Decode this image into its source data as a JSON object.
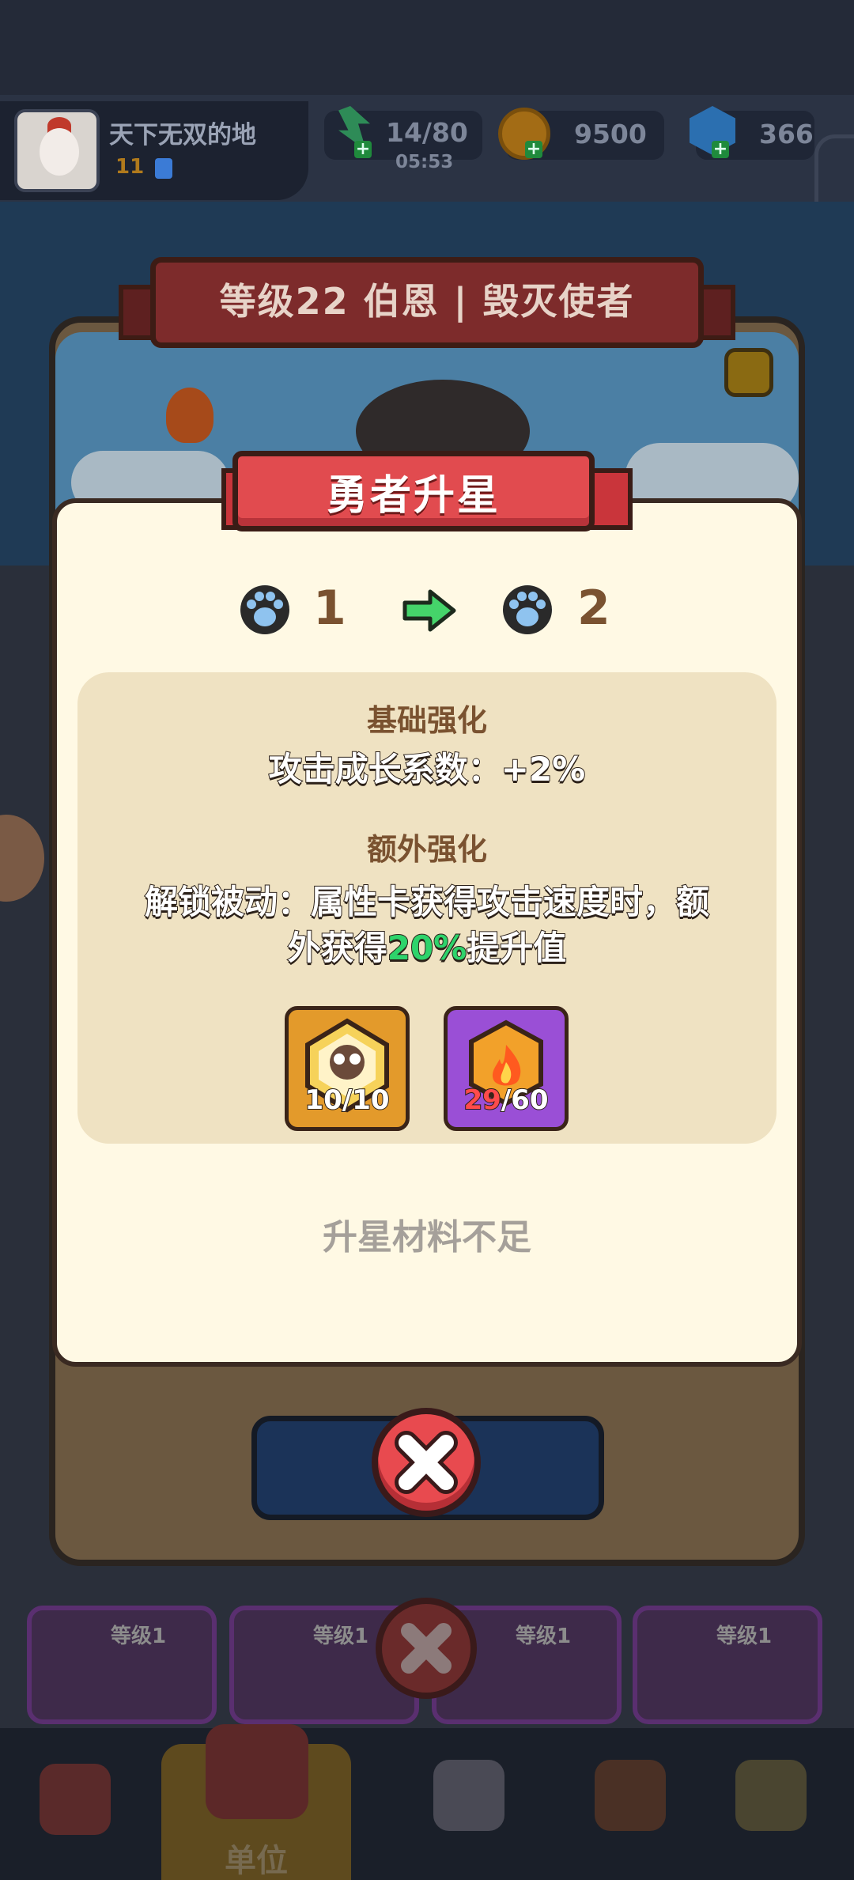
{
  "hud": {
    "player_name": "天下无双的地",
    "player_level": "11",
    "energy": "14/80",
    "energy_timer": "05:53",
    "coins": "9500",
    "gems": "366"
  },
  "hero": {
    "title": "等级22 伯恩 | 毁灭使者"
  },
  "modal": {
    "title": "勇者升星",
    "star_from": "1",
    "star_to": "2",
    "base_section_title": "基础强化",
    "base_section_body": "攻击成长系数：+2%",
    "extra_section_title": "额外强化",
    "extra_body_line1": "解锁被动：属性卡获得攻击速度时，额",
    "extra_body_line2_prefix": "外获得",
    "extra_body_highlight": "20%",
    "extra_body_line2_suffix": "提升值",
    "materials": [
      {
        "icon": "hero-shard-icon",
        "current": "10",
        "required": "10"
      },
      {
        "icon": "fire-crystal-icon",
        "current": "29",
        "required": "60"
      }
    ],
    "status": "升星材料不足"
  },
  "background_cards": [
    {
      "label": "等级1"
    },
    {
      "label": "等级1"
    },
    {
      "label": "等级1"
    },
    {
      "label": "等级1"
    }
  ],
  "nav": {
    "active_label": "单位"
  },
  "colors": {
    "modal_bg": "#fff9e4",
    "ribbon_red": "#e14b4f",
    "highlight_green": "#2ed36b",
    "insufficient_red": "#ff4b4b"
  }
}
